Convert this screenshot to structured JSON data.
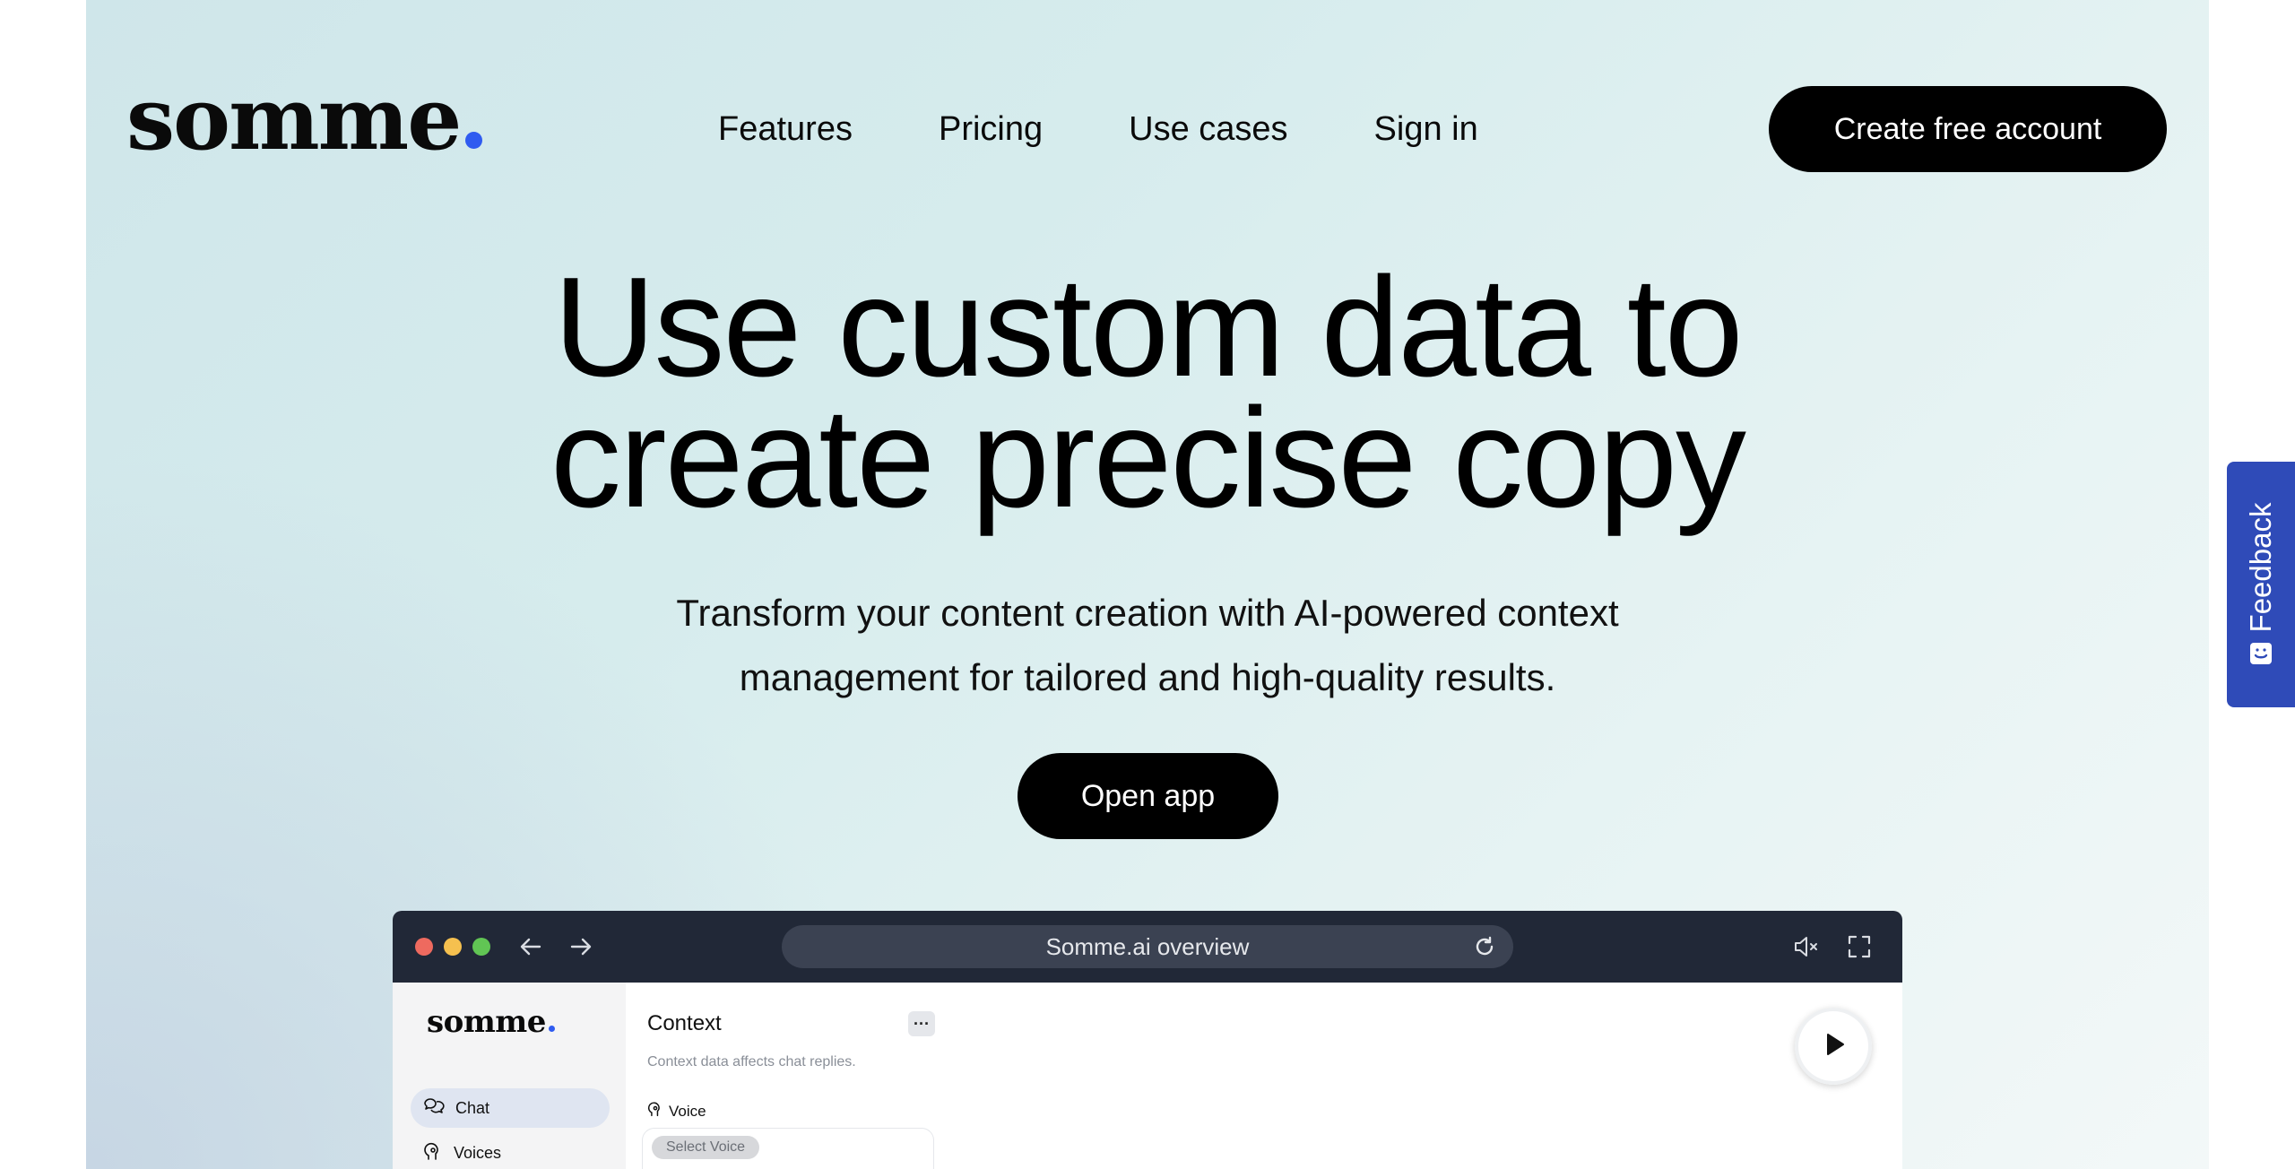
{
  "brand": {
    "logo_text": "somme",
    "accent_color": "#2f5bf0"
  },
  "nav": [
    {
      "label": "Features"
    },
    {
      "label": "Pricing"
    },
    {
      "label": "Use cases"
    },
    {
      "label": "Sign in"
    }
  ],
  "header": {
    "cta_label": "Create free account"
  },
  "hero": {
    "title_line1": "Use custom data to",
    "title_line2": "create precise copy",
    "subtitle_line1": "Transform your content creation with AI-powered context",
    "subtitle_line2": "management for tailored and high-quality results.",
    "button_label": "Open app"
  },
  "preview": {
    "url_text": "Somme.ai overview",
    "sidebar": {
      "logo_text": "somme",
      "items": [
        {
          "label": "Chat",
          "icon": "chat-icon",
          "active": true
        },
        {
          "label": "Voices",
          "icon": "voice-icon",
          "active": false
        }
      ]
    },
    "context": {
      "title": "Context",
      "more_label": "···",
      "description": "Context data affects chat replies.",
      "voice_label": "Voice",
      "select_placeholder": "Select Voice"
    }
  },
  "feedback": {
    "label": "Feedback",
    "color": "#2f4bb8"
  }
}
